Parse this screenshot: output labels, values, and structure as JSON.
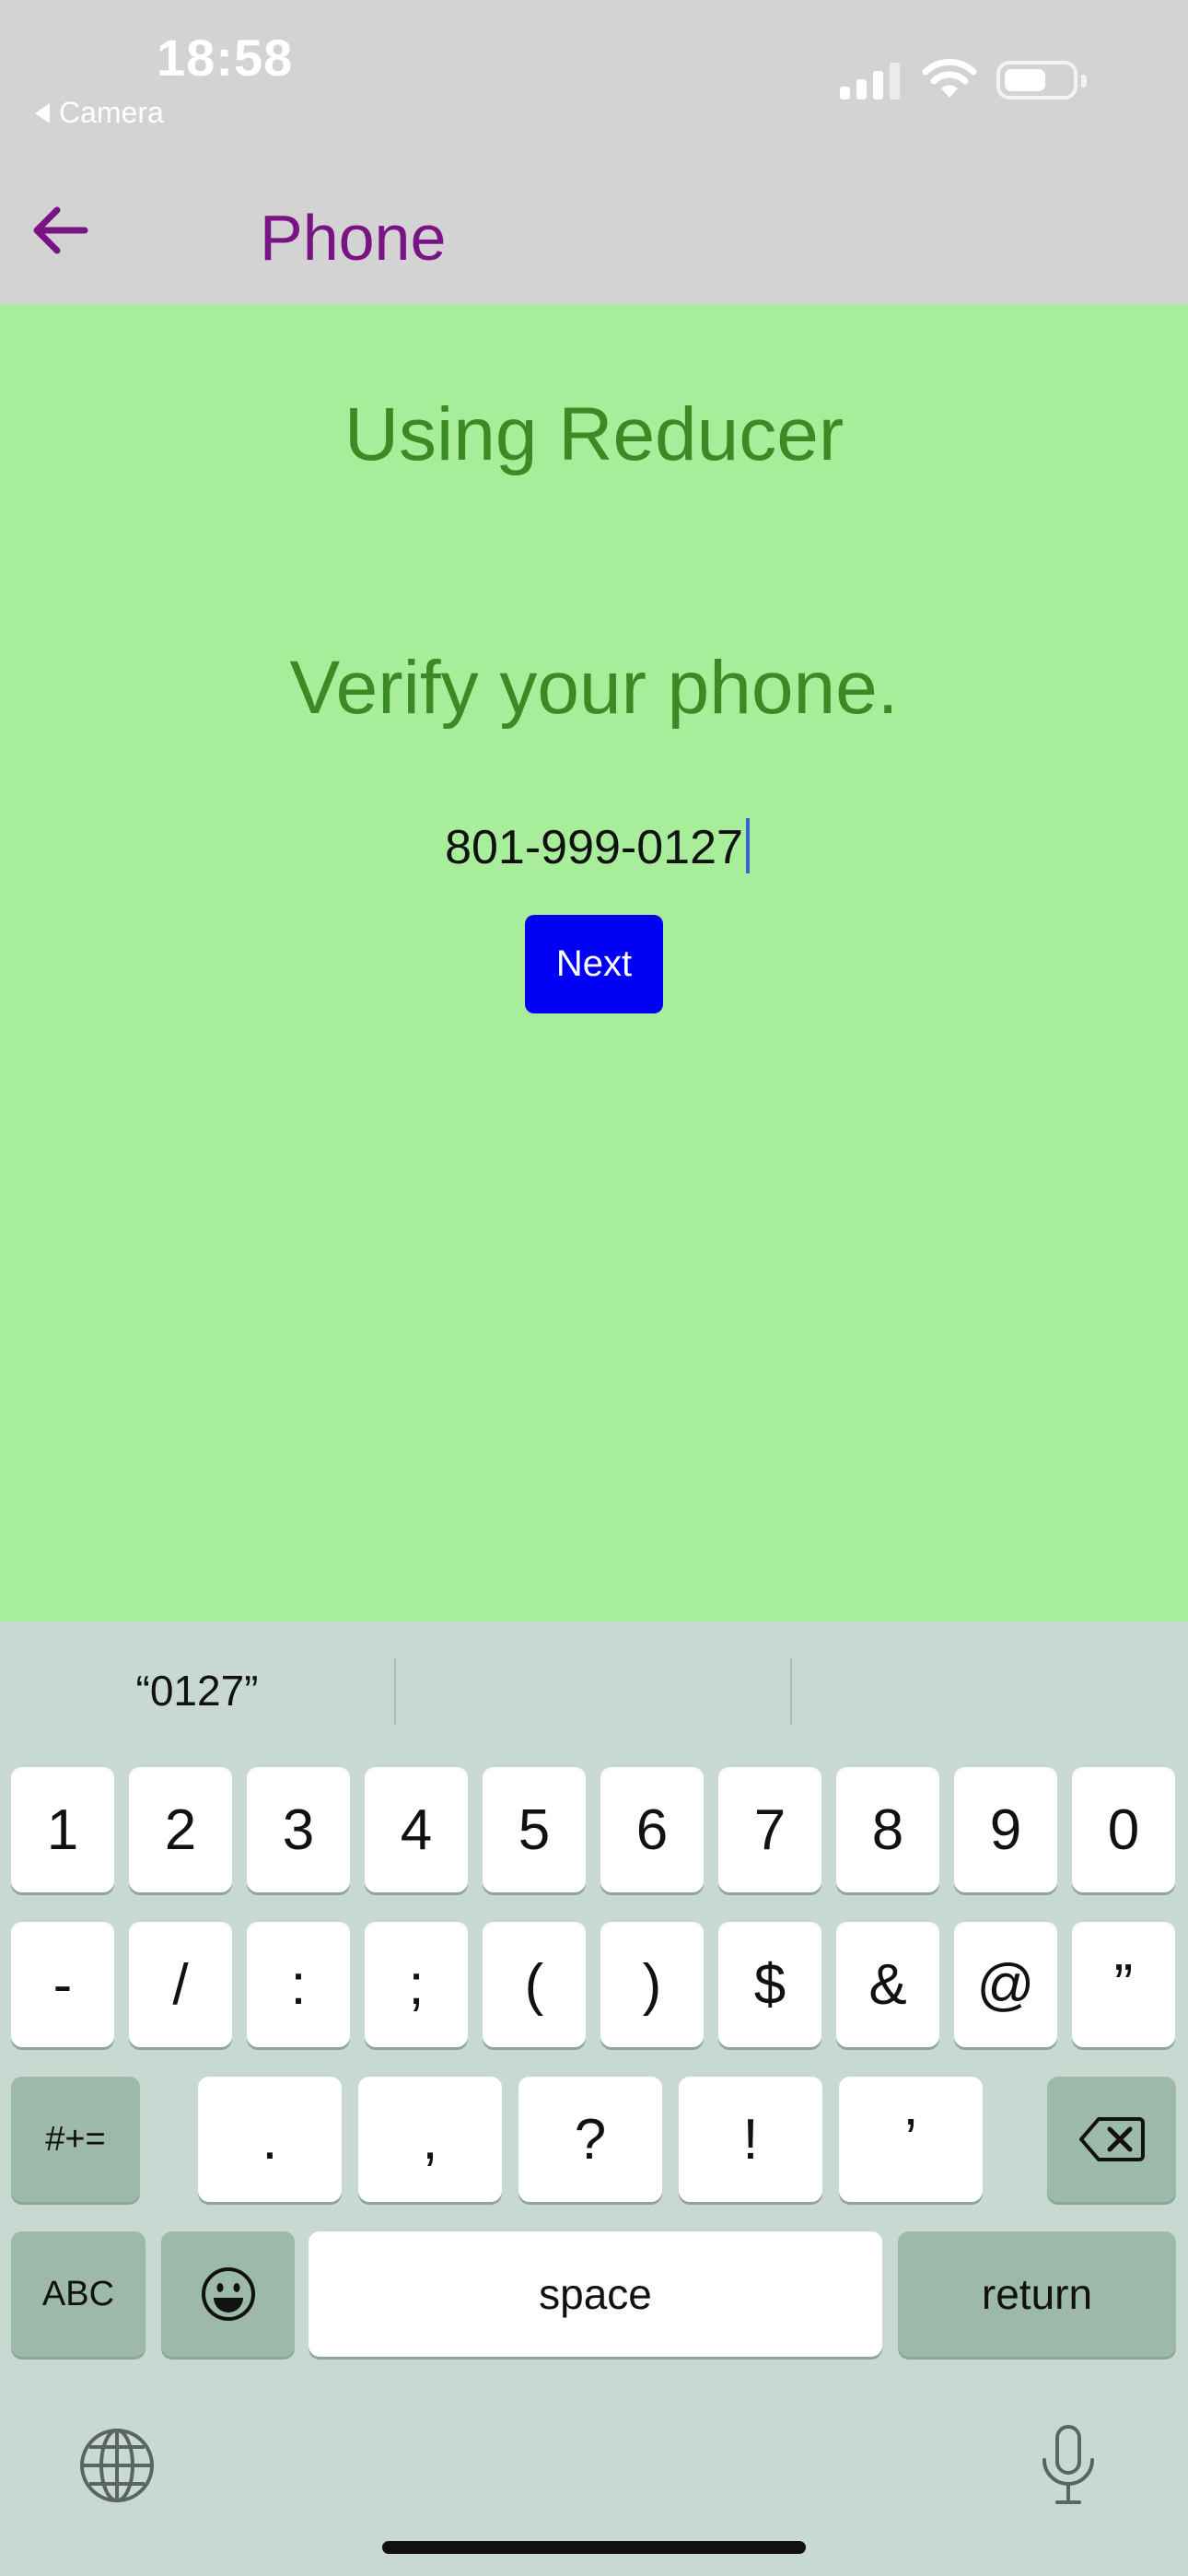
{
  "status": {
    "time": "18:58",
    "back_app": "Camera"
  },
  "nav": {
    "title": "Phone"
  },
  "content": {
    "header": "Using Reducer",
    "prompt": "Verify your phone.",
    "phone_value": "801-999-0127",
    "next_label": "Next"
  },
  "keyboard": {
    "suggestion": "“0127”",
    "row1": [
      "1",
      "2",
      "3",
      "4",
      "5",
      "6",
      "7",
      "8",
      "9",
      "0"
    ],
    "row2": [
      "-",
      "/",
      ":",
      ";",
      "(",
      ")",
      "$",
      "&",
      "@",
      "”"
    ],
    "row3": [
      ".",
      ",",
      "?",
      "!",
      "’"
    ],
    "symbols_label": "#+=",
    "abc_label": "ABC",
    "space_label": "space",
    "return_label": "return"
  },
  "colors": {
    "content_bg": "#a8ee9a",
    "heading_text": "#3b8a23",
    "nav_title": "#7a1485",
    "button_bg": "#0000f5",
    "keyboard_bg": "#c7d9d1"
  },
  "icons": {
    "back": "arrow-left-icon",
    "signal": "cellular-signal-icon",
    "wifi": "wifi-icon",
    "battery": "battery-icon",
    "delete": "backspace-icon",
    "emoji": "emoji-icon",
    "globe": "globe-icon",
    "mic": "microphone-icon"
  }
}
